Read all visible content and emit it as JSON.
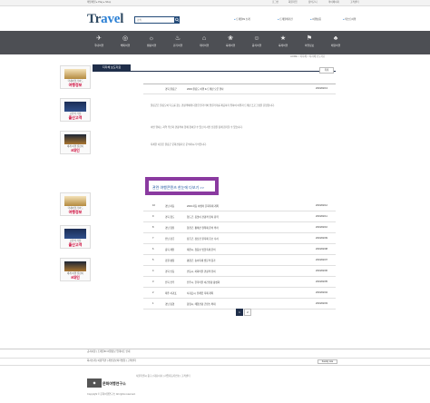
{
  "top_strip": {
    "left_text": "매일매일 ▸ Play ▸ Shop",
    "right_links": [
      "로그인",
      "회원가입",
      "장바구니",
      "마이페이지",
      "고객센터"
    ]
  },
  "logo": {
    "prefix": "Tr",
    "accent": "ave",
    "suffix": "l"
  },
  "search": {
    "placeholder": "검색"
  },
  "header_links": [
    "트래블IN 소개",
    "트래블매거진",
    "여행상품",
    "테스트여행"
  ],
  "nav": [
    {
      "icon": "✈",
      "label": "국내여행"
    },
    {
      "icon": "◎",
      "label": "해외여행"
    },
    {
      "icon": "☼",
      "label": "캠핑여행"
    },
    {
      "icon": "♨",
      "label": "걷기여행"
    },
    {
      "icon": "⌂",
      "label": "테마여행"
    },
    {
      "icon": "❀",
      "label": "축제여행"
    },
    {
      "icon": "☺",
      "label": "음식여행"
    },
    {
      "icon": "★",
      "label": "축제여행"
    },
    {
      "icon": "⚑",
      "label": "여행정보"
    },
    {
      "icon": "♣",
      "label": "체험여행"
    }
  ],
  "breadcrumb": "HOME > 지자체 > 지자체 보도자료",
  "page_title": "지자체 보도자료",
  "list_button": "목록",
  "article_header": {
    "num": "",
    "region": "",
    "title": "",
    "date": ""
  },
  "article": {
    "region": "경북 울릉군",
    "title": "2019 울릉도 여행 & 트레킹 오픈 행사",
    "date": "2019/02/13"
  },
  "body_paragraphs": [
    "울릉군은 울릉도와 독도를 찾는 관광객에게 다양한 볼거리와 즐길거리를 제공하기 위하여 여행과 트레킹 프로그램을 운영합니다.",
    "이번 행사는 지역 주민과 관광객이 함께 참여할 수 있으며 사전 신청을 통해 참가할 수 있습니다.",
    "자세한 사항은 울릉군 문화관광과로 문의하시기 바랍니다."
  ],
  "highlight_link": "관련 여행콘텐츠 한눈에 다보기 >>",
  "related_rows": [
    {
      "num": "10",
      "region": "경남 하동",
      "title": "2019 하동 야생차 문화축제 개최",
      "date": "2019/02/12"
    },
    {
      "num": "9",
      "region": "경북 청도",
      "title": "청도군, 봄맞이 관광객 유치 총력",
      "date": "2019/02/11"
    },
    {
      "num": "8",
      "region": "경남 합천",
      "title": "합천군, 황매산 철쭉제 준비 박차",
      "date": "2019/02/10"
    },
    {
      "num": "7",
      "region": "전남 장흥",
      "title": "장흥군, 정남진 물축제 홍보 나서",
      "date": "2019/02/09"
    },
    {
      "num": "6",
      "region": "충북 제천",
      "title": "제천시, 청풍호 벚꽃축제 준비",
      "date": "2019/02/08"
    },
    {
      "num": "5",
      "region": "강원 평창",
      "title": "평창군, 송어축제 방문객 증가",
      "date": "2019/02/07"
    },
    {
      "num": "4",
      "region": "경북 안동",
      "title": "안동시, 하회마을 관광객 유치",
      "date": "2019/02/06"
    },
    {
      "num": "3",
      "region": "전북 전주",
      "title": "전주시, 한옥마을 야간관광 활성화",
      "date": "2019/02/05"
    },
    {
      "num": "2",
      "region": "제주 서귀포",
      "title": "서귀포시, 유채꽃 축제 개최",
      "date": "2019/02/04"
    },
    {
      "num": "1",
      "region": "경남 통영",
      "title": "통영시, 해양관광 콘텐츠 확대",
      "date": "2019/02/03"
    }
  ],
  "pager": [
    "1",
    "2"
  ],
  "side_cards": [
    {
      "text": "국내여행 가이드",
      "strong": "여행정보"
    },
    {
      "text": "교류의 거점",
      "strong": "출산고객"
    },
    {
      "text": "세계 여행 길잡이",
      "strong": "5대인"
    },
    {
      "text": "국내여행 가이드",
      "strong": "여행정보"
    },
    {
      "text": "교류의 거점",
      "strong": "출산고객"
    },
    {
      "text": "세계 여행 길잡이",
      "strong": "5대인"
    }
  ],
  "footer": {
    "notice": "공지사항 | 트래블IN 여행정보 업데이트 안내",
    "links": "회사소개 | 이용약관 | 개인정보처리방침 | 고객센터",
    "family_site": "Family site",
    "brand": "문화여행연구소",
    "address": "서울특별시 중구 | 대표이사 | 사업자등록번호 | 고객센터",
    "copyright": "Copyright © 문화여행연구소 All rights reserved."
  }
}
